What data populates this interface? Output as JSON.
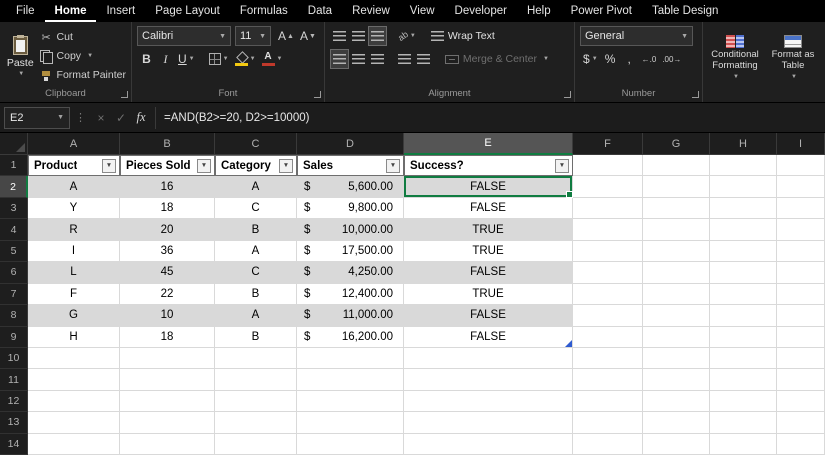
{
  "tabs": {
    "items": [
      "File",
      "Home",
      "Insert",
      "Page Layout",
      "Formulas",
      "Data",
      "Review",
      "View",
      "Developer",
      "Help",
      "Power Pivot",
      "Table Design"
    ],
    "active": "Home"
  },
  "icons": {
    "dropdown": "▼",
    "up": "▲",
    "cut": "✂",
    "cancel": "×",
    "enter": "✓",
    "dots": "⋮",
    "orientation_ab": "ab"
  },
  "ribbon": {
    "clipboard": {
      "label": "Clipboard",
      "paste": "Paste",
      "cut": "Cut",
      "copy": "Copy",
      "format_painter": "Format Painter"
    },
    "font": {
      "label": "Font",
      "font_name": "Calibri",
      "font_size": "11",
      "bold": "B",
      "italic": "I",
      "underline": "U",
      "grow_letter": "A"
    },
    "alignment": {
      "label": "Alignment",
      "wrap_text": "Wrap Text",
      "merge_center": "Merge & Center"
    },
    "number": {
      "label": "Number",
      "format": "General",
      "currency": "$",
      "percent": "%",
      "comma": ",",
      "increase_decimal": "←.0",
      "decrease_decimal": ".00→"
    },
    "styles": {
      "conditional_formatting": "Conditional Formatting",
      "format_as_table": "Format as Table"
    }
  },
  "formula_bar": {
    "name_box": "E2",
    "fx": "fx",
    "formula": "=AND(B2>=20, D2>=10000)"
  },
  "grid": {
    "column_headers": [
      "A",
      "B",
      "C",
      "D",
      "E",
      "F",
      "G",
      "H",
      "I"
    ],
    "row_headers": [
      "1",
      "2",
      "3",
      "4",
      "5",
      "6",
      "7",
      "8",
      "9",
      "10",
      "11",
      "12",
      "13",
      "14"
    ],
    "selected_column": "E",
    "selected_row": "2",
    "active_cell": "E2",
    "table": {
      "headers": [
        "Product",
        "Pieces Sold",
        "Category",
        "Sales",
        "Success?"
      ],
      "rows": [
        {
          "product": "A",
          "pieces": "16",
          "category": "A",
          "currency": "$",
          "sales": "5,600.00",
          "success": "FALSE"
        },
        {
          "product": "Y",
          "pieces": "18",
          "category": "C",
          "currency": "$",
          "sales": "9,800.00",
          "success": "FALSE"
        },
        {
          "product": "R",
          "pieces": "20",
          "category": "B",
          "currency": "$",
          "sales": "10,000.00",
          "success": "TRUE"
        },
        {
          "product": "I",
          "pieces": "36",
          "category": "A",
          "currency": "$",
          "sales": "17,500.00",
          "success": "TRUE"
        },
        {
          "product": "L",
          "pieces": "45",
          "category": "C",
          "currency": "$",
          "sales": "4,250.00",
          "success": "FALSE"
        },
        {
          "product": "F",
          "pieces": "22",
          "category": "B",
          "currency": "$",
          "sales": "12,400.00",
          "success": "TRUE"
        },
        {
          "product": "G",
          "pieces": "10",
          "category": "A",
          "currency": "$",
          "sales": "11,000.00",
          "success": "FALSE"
        },
        {
          "product": "H",
          "pieces": "18",
          "category": "B",
          "currency": "$",
          "sales": "16,200.00",
          "success": "FALSE"
        }
      ]
    },
    "colors": {
      "selection": "#107C41",
      "band": "#D9D9D9",
      "table_handle": "#2F5BD0"
    }
  }
}
